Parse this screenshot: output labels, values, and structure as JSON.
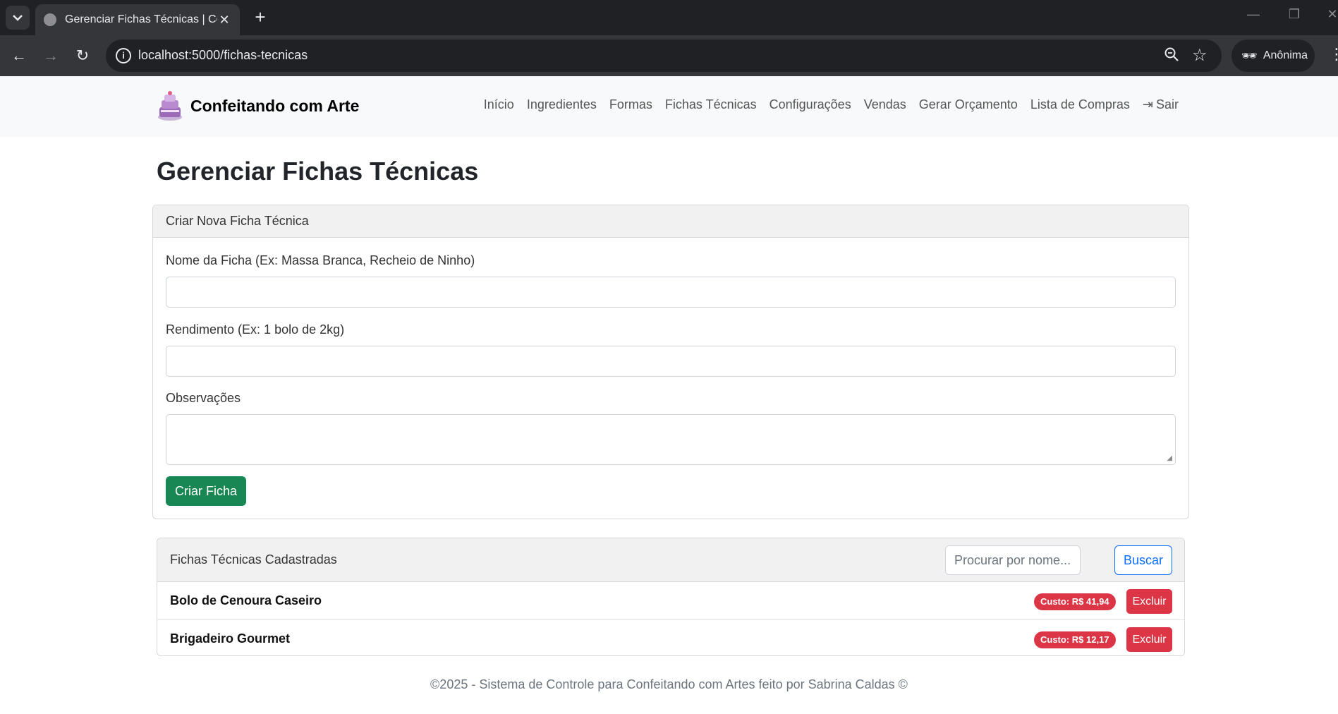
{
  "browser": {
    "tab_title": "Gerenciar Fichas Técnicas | Conf",
    "url": "localhost:5000/fichas-tecnicas",
    "profile_label": "Anônima",
    "icons": [
      "tab-list-icon",
      "globe-icon",
      "close-icon",
      "plus-icon",
      "back-icon",
      "forward-icon",
      "reload-icon",
      "info-icon",
      "zoom-icon",
      "star-icon",
      "incognito-icon",
      "menu-icon",
      "minimize-icon",
      "restore-icon"
    ]
  },
  "navbar": {
    "brand": "Confeitando com Arte",
    "links": [
      "Início",
      "Ingredientes",
      "Formas",
      "Fichas Técnicas",
      "Configurações",
      "Vendas",
      "Gerar Orçamento",
      "Lista de Compras"
    ],
    "logout": "Sair"
  },
  "page": {
    "title": "Gerenciar Fichas Técnicas"
  },
  "create_form": {
    "header": "Criar Nova Ficha Técnica",
    "name_label": "Nome da Ficha (Ex: Massa Branca, Recheio de Ninho)",
    "name_value": "",
    "yield_label": "Rendimento (Ex: 1 bolo de 2kg)",
    "yield_value": "",
    "notes_label": "Observações",
    "notes_value": "",
    "submit_label": "Criar Ficha"
  },
  "list": {
    "header": "Fichas Técnicas Cadastradas",
    "search_placeholder": "Procurar por nome...",
    "search_button": "Buscar",
    "items": [
      {
        "name": "Bolo de Cenoura Caseiro",
        "cost": "Custo: R$ 41,94",
        "delete_label": "Excluir"
      },
      {
        "name": "Brigadeiro Gourmet",
        "cost": "Custo: R$ 12,17",
        "delete_label": "Excluir"
      }
    ]
  },
  "footer": {
    "text": "©2025 - Sistema de Controle para Confeitando com Artes feito por Sabrina Caldas ©"
  },
  "colors": {
    "success": "#198754",
    "danger": "#dc3545",
    "primary": "#0d6efd",
    "navbar_bg": "#f8f9fa",
    "chrome_dark": "#202124"
  }
}
